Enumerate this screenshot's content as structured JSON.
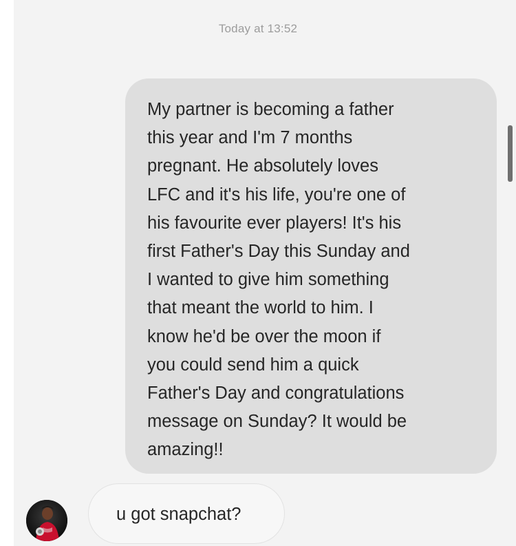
{
  "conversation": {
    "timestamp": "Today at 13:52",
    "messages": [
      {
        "direction": "sent",
        "text": "My partner is becoming a father\nthis year and I'm 7 months\npregnant. He absolutely loves\nLFC and it's his life, you're one of\nhis favourite ever players! It's his\nfirst Father's Day this Sunday and\nI wanted to give him something\nthat meant the world to him. I\nknow he'd be over the moon if\nyou could send him a quick\nFather's Day and congratulations\nmessage on Sunday? It would be\namazing!!"
      },
      {
        "direction": "received",
        "text": "u got snapchat?"
      }
    ]
  },
  "colors": {
    "background": "#f3f3f3",
    "sent_bubble": "#dedede",
    "received_bubble": "#f7f7f7",
    "received_border": "#e2e2e2",
    "text": "#262626",
    "timestamp": "#9c9c9c"
  }
}
